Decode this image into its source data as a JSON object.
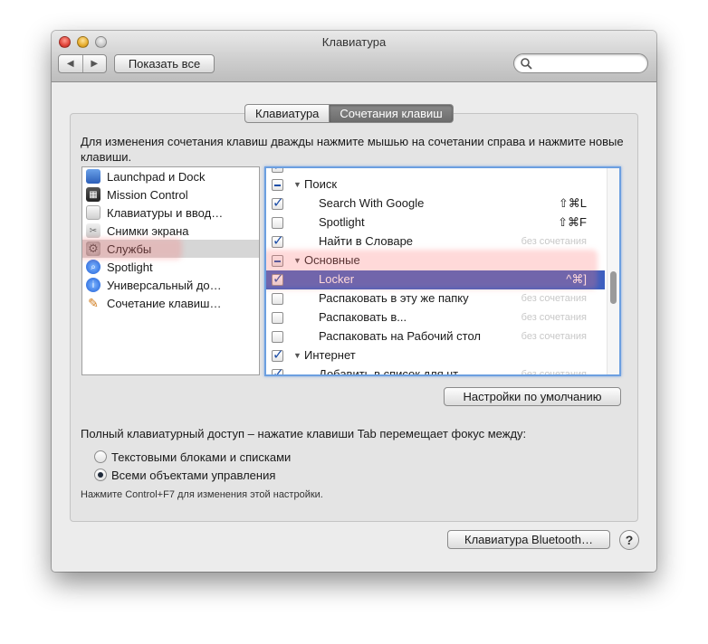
{
  "window": {
    "title": "Клавиатура"
  },
  "toolbar": {
    "back": "◀",
    "forward": "▶",
    "show_all": "Показать все",
    "search_placeholder": ""
  },
  "tabs": [
    {
      "label": "Клавиатура"
    },
    {
      "label": "Сочетания клавиш"
    }
  ],
  "instructions": "Для изменения сочетания клавиш дважды нажмите мышью на сочетании справа и нажмите новые клавиши.",
  "categories": [
    {
      "label": "Launchpad и Dock",
      "icon": "launchpad-icon"
    },
    {
      "label": "Mission Control",
      "icon": "mission-control-icon"
    },
    {
      "label": "Клавиатуры и ввод…",
      "icon": "keyboard-icon"
    },
    {
      "label": "Снимки экрана",
      "icon": "screenshot-icon"
    },
    {
      "label": "Службы",
      "icon": "gear-icon"
    },
    {
      "label": "Spotlight",
      "icon": "spotlight-icon"
    },
    {
      "label": "Универсальный до…",
      "icon": "accessibility-icon"
    },
    {
      "label": "Сочетание клавиш…",
      "icon": "app-shortcuts-icon"
    }
  ],
  "selected_category": "Службы",
  "shortcuts": [
    {
      "label": "",
      "shortcut": ""
    },
    {
      "label": "Поиск",
      "group": true,
      "state": "mixed"
    },
    {
      "label": "Search With Google",
      "shortcut": "⇧⌘L",
      "state": "on"
    },
    {
      "label": "Spotlight",
      "shortcut": "⇧⌘F",
      "state": "off"
    },
    {
      "label": "Найти в Словаре",
      "shortcut": "без сочетания",
      "state": "on"
    },
    {
      "label": "Основные",
      "group": true,
      "state": "mixed"
    },
    {
      "label": "Locker",
      "shortcut": "^⌘]",
      "state": "on",
      "selected": true
    },
    {
      "label": "Распаковать в эту же папку",
      "shortcut": "без сочетания",
      "state": "off"
    },
    {
      "label": "Распаковать в...",
      "shortcut": "без сочетания",
      "state": "off"
    },
    {
      "label": "Распаковать на Рабочий стол",
      "shortcut": "без сочетания",
      "state": "off"
    },
    {
      "label": "Интернет",
      "group": true,
      "state": "on"
    },
    {
      "label": "Добавить в список для чт…",
      "shortcut": "без сочетания",
      "state": "on"
    }
  ],
  "restore_defaults": "Настройки по умолчанию",
  "full_keyboard_access": {
    "description": "Полный клавиатурный доступ – нажатие клавиши Tab перемещает фокус между:",
    "options": [
      "Текстовыми блоками и списками",
      "Всеми объектами управления"
    ],
    "selected_index": 1,
    "hint": "Нажмите Control+F7 для изменения этой настройки."
  },
  "bluetooth_button": "Клавиатура Bluetooth…",
  "help_button": "?",
  "colors": {
    "selection": "#3b5fc0",
    "focus_ring": "#6c9fe0",
    "highlight": "#ff7878"
  }
}
